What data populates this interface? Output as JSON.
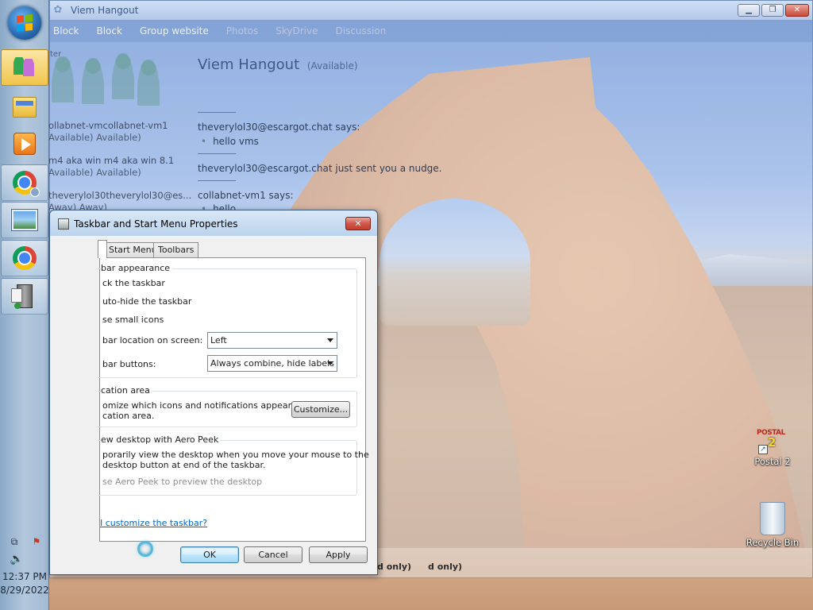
{
  "taskbar": {
    "clock_time": "12:37 PM",
    "clock_date": "8/29/2022",
    "items": [
      {
        "name": "messenger",
        "icon": "messenger-icon",
        "active": true
      },
      {
        "name": "explorer",
        "icon": "folder-icon"
      },
      {
        "name": "media-player",
        "icon": "media-player-icon"
      },
      {
        "name": "chrome-profile",
        "icon": "chrome-user-icon"
      },
      {
        "name": "photo-viewer",
        "icon": "picture-icon"
      },
      {
        "name": "chrome",
        "icon": "chrome-icon"
      },
      {
        "name": "server",
        "icon": "server-icon"
      }
    ]
  },
  "chat_window": {
    "title": "Viem Hangout",
    "menu": [
      "Block",
      "Block",
      "Group website",
      "Photos",
      "SkyDrive",
      "Discussion"
    ],
    "sidebar_label": "ter",
    "contacts": [
      {
        "name": "ollabnet-vmcollabnet-vm1",
        "status": "Available)   Available)"
      },
      {
        "name": "m4 aka win m4 aka win 8.1",
        "status": "Available)   Available)"
      },
      {
        "name": "theverylol30theverylol30@es...",
        "status": "Away)       Away)"
      }
    ],
    "conversation_title": "Viem Hangout",
    "conversation_status": "(Available)",
    "messages": [
      {
        "header": "theverylol30@escargot.chat says:",
        "text": "hello vms"
      },
      {
        "nudge": "theverylol30@escargot.chat just sent you a nudge."
      },
      {
        "header": "collabnet-vm1 says:",
        "text": "hello"
      }
    ],
    "faint_bottom": [
      "d only)",
      "d only)"
    ]
  },
  "dialog": {
    "title": "Taskbar and Start Menu Properties",
    "tabs": [
      "Start Menu",
      "Toolbars"
    ],
    "appearance_group": "bar appearance",
    "lock_taskbar": "ck the taskbar",
    "auto_hide": "uto-hide the taskbar",
    "small_icons": "se small icons",
    "location_label": "bar location on screen:",
    "location_value": "Left",
    "buttons_label": "bar buttons:",
    "buttons_value": "Always combine, hide labels",
    "notification_group": "cation area",
    "notification_text_1": "omize which icons and notifications appear in the",
    "notification_text_2": "cation area.",
    "customize_button": "Customize...",
    "aero_group": "ew desktop with Aero Peek",
    "aero_text_1": "porarily view the desktop when you move your mouse to the",
    "aero_text_2": "desktop button at end of the taskbar.",
    "aero_checkbox": "se Aero Peek to preview the desktop",
    "help_link": "I customize the taskbar?",
    "ok": "OK",
    "cancel": "Cancel",
    "apply": "Apply"
  },
  "desktop": {
    "icons": [
      {
        "label": "Postal 2",
        "image_text": "POSTAL",
        "image_number": "2",
        "icon": "postal2-icon"
      },
      {
        "label": "Recycle Bin",
        "icon": "recycle-bin-icon"
      }
    ]
  },
  "colors": {
    "taskbar_active": "#f1c54c",
    "dialog_frame": "#b9d1ea",
    "link": "#0066cc"
  }
}
